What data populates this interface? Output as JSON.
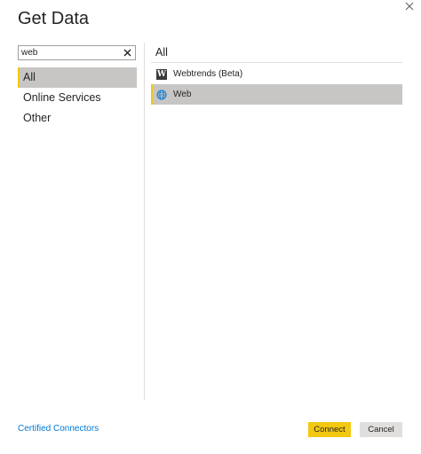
{
  "dialog": {
    "title": "Get Data"
  },
  "search": {
    "value": "web",
    "placeholder": ""
  },
  "categories": [
    {
      "label": "All",
      "selected": true
    },
    {
      "label": "Online Services",
      "selected": false
    },
    {
      "label": "Other",
      "selected": false
    }
  ],
  "panel": {
    "title": "All",
    "items": [
      {
        "label": "Webtrends (Beta)",
        "icon": "webtrends-icon",
        "selected": false
      },
      {
        "label": "Web",
        "icon": "globe-icon",
        "selected": true
      }
    ]
  },
  "footer": {
    "certified_link": "Certified Connectors",
    "connect_label": "Connect",
    "cancel_label": "Cancel"
  },
  "colors": {
    "accent": "#f2c811",
    "selected_bg": "#c8c6c4",
    "link": "#0078d4"
  }
}
